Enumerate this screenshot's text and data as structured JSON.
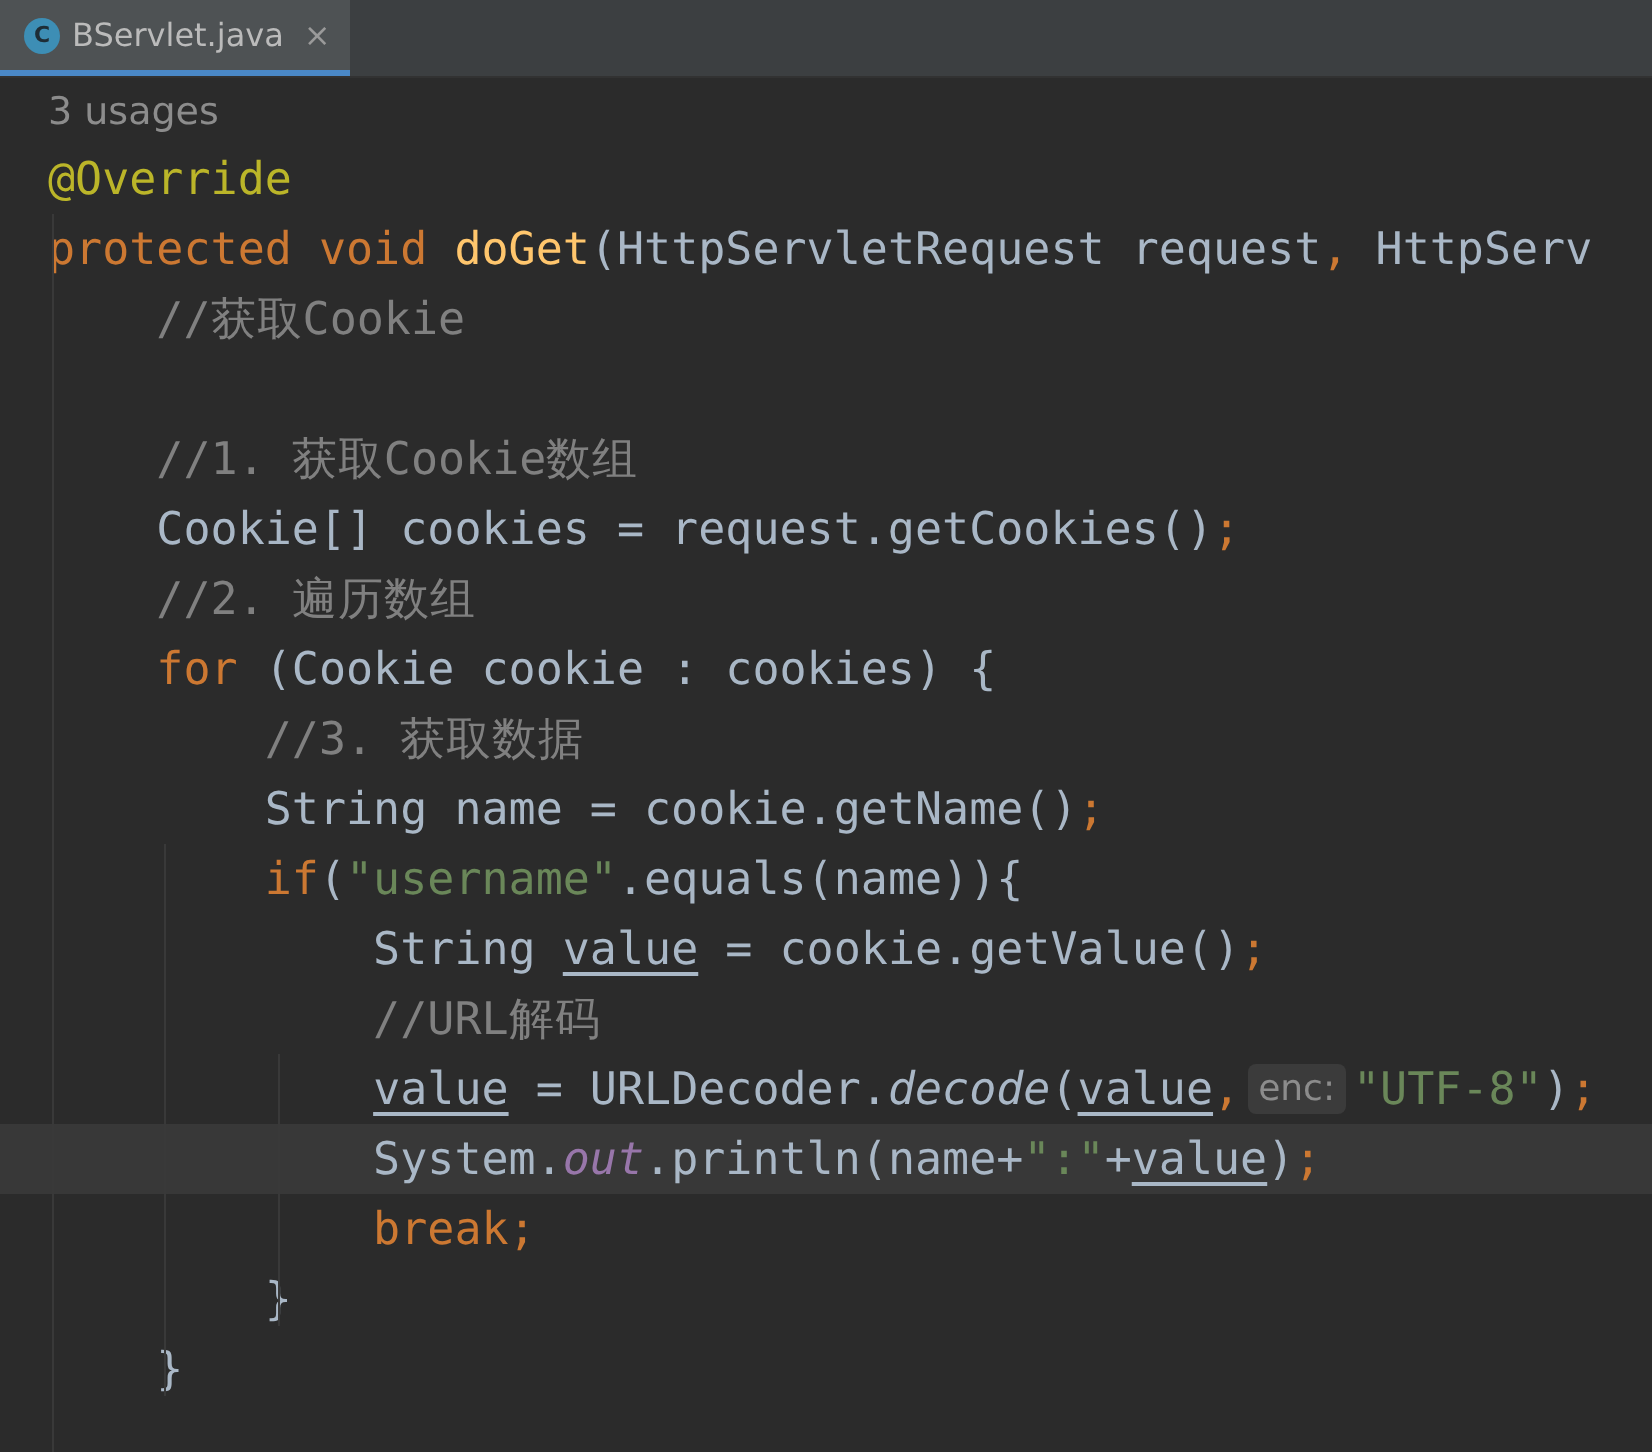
{
  "tabs": [
    {
      "label": "BServlet.java",
      "icon": "C",
      "close": "×",
      "selected": true
    }
  ],
  "usages": "3 usages",
  "lines": [
    {
      "current": false,
      "tokens": [
        {
          "kind": "annotation",
          "text": "@Override"
        }
      ]
    },
    {
      "current": false,
      "tokens": [
        {
          "kind": "keyword",
          "text": "protected void "
        },
        {
          "kind": "method",
          "text": "doGet"
        },
        {
          "kind": "plain",
          "text": "(HttpServletRequest request"
        },
        {
          "kind": "keyword",
          "text": ", "
        },
        {
          "kind": "plain",
          "text": "HttpServ"
        }
      ]
    },
    {
      "current": false,
      "tokens": [
        {
          "kind": "comment",
          "text": "    //获取Cookie"
        }
      ]
    },
    {
      "current": false
    },
    {
      "current": false,
      "tokens": [
        {
          "kind": "comment",
          "text": "    //1. 获取Cookie数组"
        }
      ]
    },
    {
      "current": false,
      "tokens": [
        {
          "kind": "plain",
          "text": "    Cookie[] cookies = request.getCookies()"
        },
        {
          "kind": "keyword",
          "text": ";"
        }
      ]
    },
    {
      "current": false,
      "tokens": [
        {
          "kind": "comment",
          "text": "    //2. 遍历数组"
        }
      ]
    },
    {
      "current": false,
      "tokens": [
        {
          "kind": "keyword",
          "text": "    for "
        },
        {
          "kind": "plain",
          "text": "(Cookie cookie : cookies) {"
        }
      ]
    },
    {
      "current": false,
      "tokens": [
        {
          "kind": "comment",
          "text": "        //3. 获取数据"
        }
      ]
    },
    {
      "current": false,
      "tokens": [
        {
          "kind": "plain",
          "text": "        String name = cookie.getName()"
        },
        {
          "kind": "keyword",
          "text": ";"
        }
      ]
    },
    {
      "current": false,
      "tokens": [
        {
          "kind": "keyword",
          "text": "        if"
        },
        {
          "kind": "plain",
          "text": "("
        },
        {
          "kind": "string",
          "text": "\"username\""
        },
        {
          "kind": "plain",
          "text": ".equals(name)){"
        }
      ]
    },
    {
      "current": false,
      "tokens": [
        {
          "kind": "plain",
          "text": "            String "
        },
        {
          "kind": "variable",
          "text": "value"
        },
        {
          "kind": "plain",
          "text": " = cookie.getValue()"
        },
        {
          "kind": "keyword",
          "text": ";"
        }
      ]
    },
    {
      "current": false,
      "tokens": [
        {
          "kind": "comment",
          "text": "            //URL解码"
        }
      ]
    },
    {
      "current": false,
      "tokens": [
        {
          "kind": "variable",
          "text": "            value"
        },
        {
          "kind": "plain",
          "text": " = URLDecoder."
        },
        {
          "kind": "static-method",
          "text": "decode"
        },
        {
          "kind": "plain",
          "text": "("
        },
        {
          "kind": "variable",
          "text": "value"
        },
        {
          "kind": "keyword",
          "text": ","
        },
        {
          "kind": "hint",
          "text": "enc:"
        },
        {
          "kind": "string",
          "text": "\"UTF-8\""
        },
        {
          "kind": "plain",
          "text": ")"
        },
        {
          "kind": "keyword",
          "text": ";"
        }
      ]
    },
    {
      "current": true,
      "tokens": [
        {
          "kind": "plain",
          "text": "            System."
        },
        {
          "kind": "static-field",
          "text": "out"
        },
        {
          "kind": "plain",
          "text": ".println(name+"
        },
        {
          "kind": "string",
          "text": "\":\""
        },
        {
          "kind": "plain",
          "text": "+"
        },
        {
          "kind": "variable",
          "text": "value"
        },
        {
          "kind": "plain",
          "text": ")"
        },
        {
          "kind": "keyword",
          "text": ";"
        }
      ]
    },
    {
      "current": false,
      "tokens": [
        {
          "kind": "keyword",
          "text": "            break;"
        }
      ]
    },
    {
      "current": false,
      "tokens": [
        {
          "kind": "plain",
          "text": "        }"
        }
      ]
    },
    {
      "current": false,
      "tokens": [
        {
          "kind": "plain",
          "text": "    }"
        }
      ]
    }
  ]
}
